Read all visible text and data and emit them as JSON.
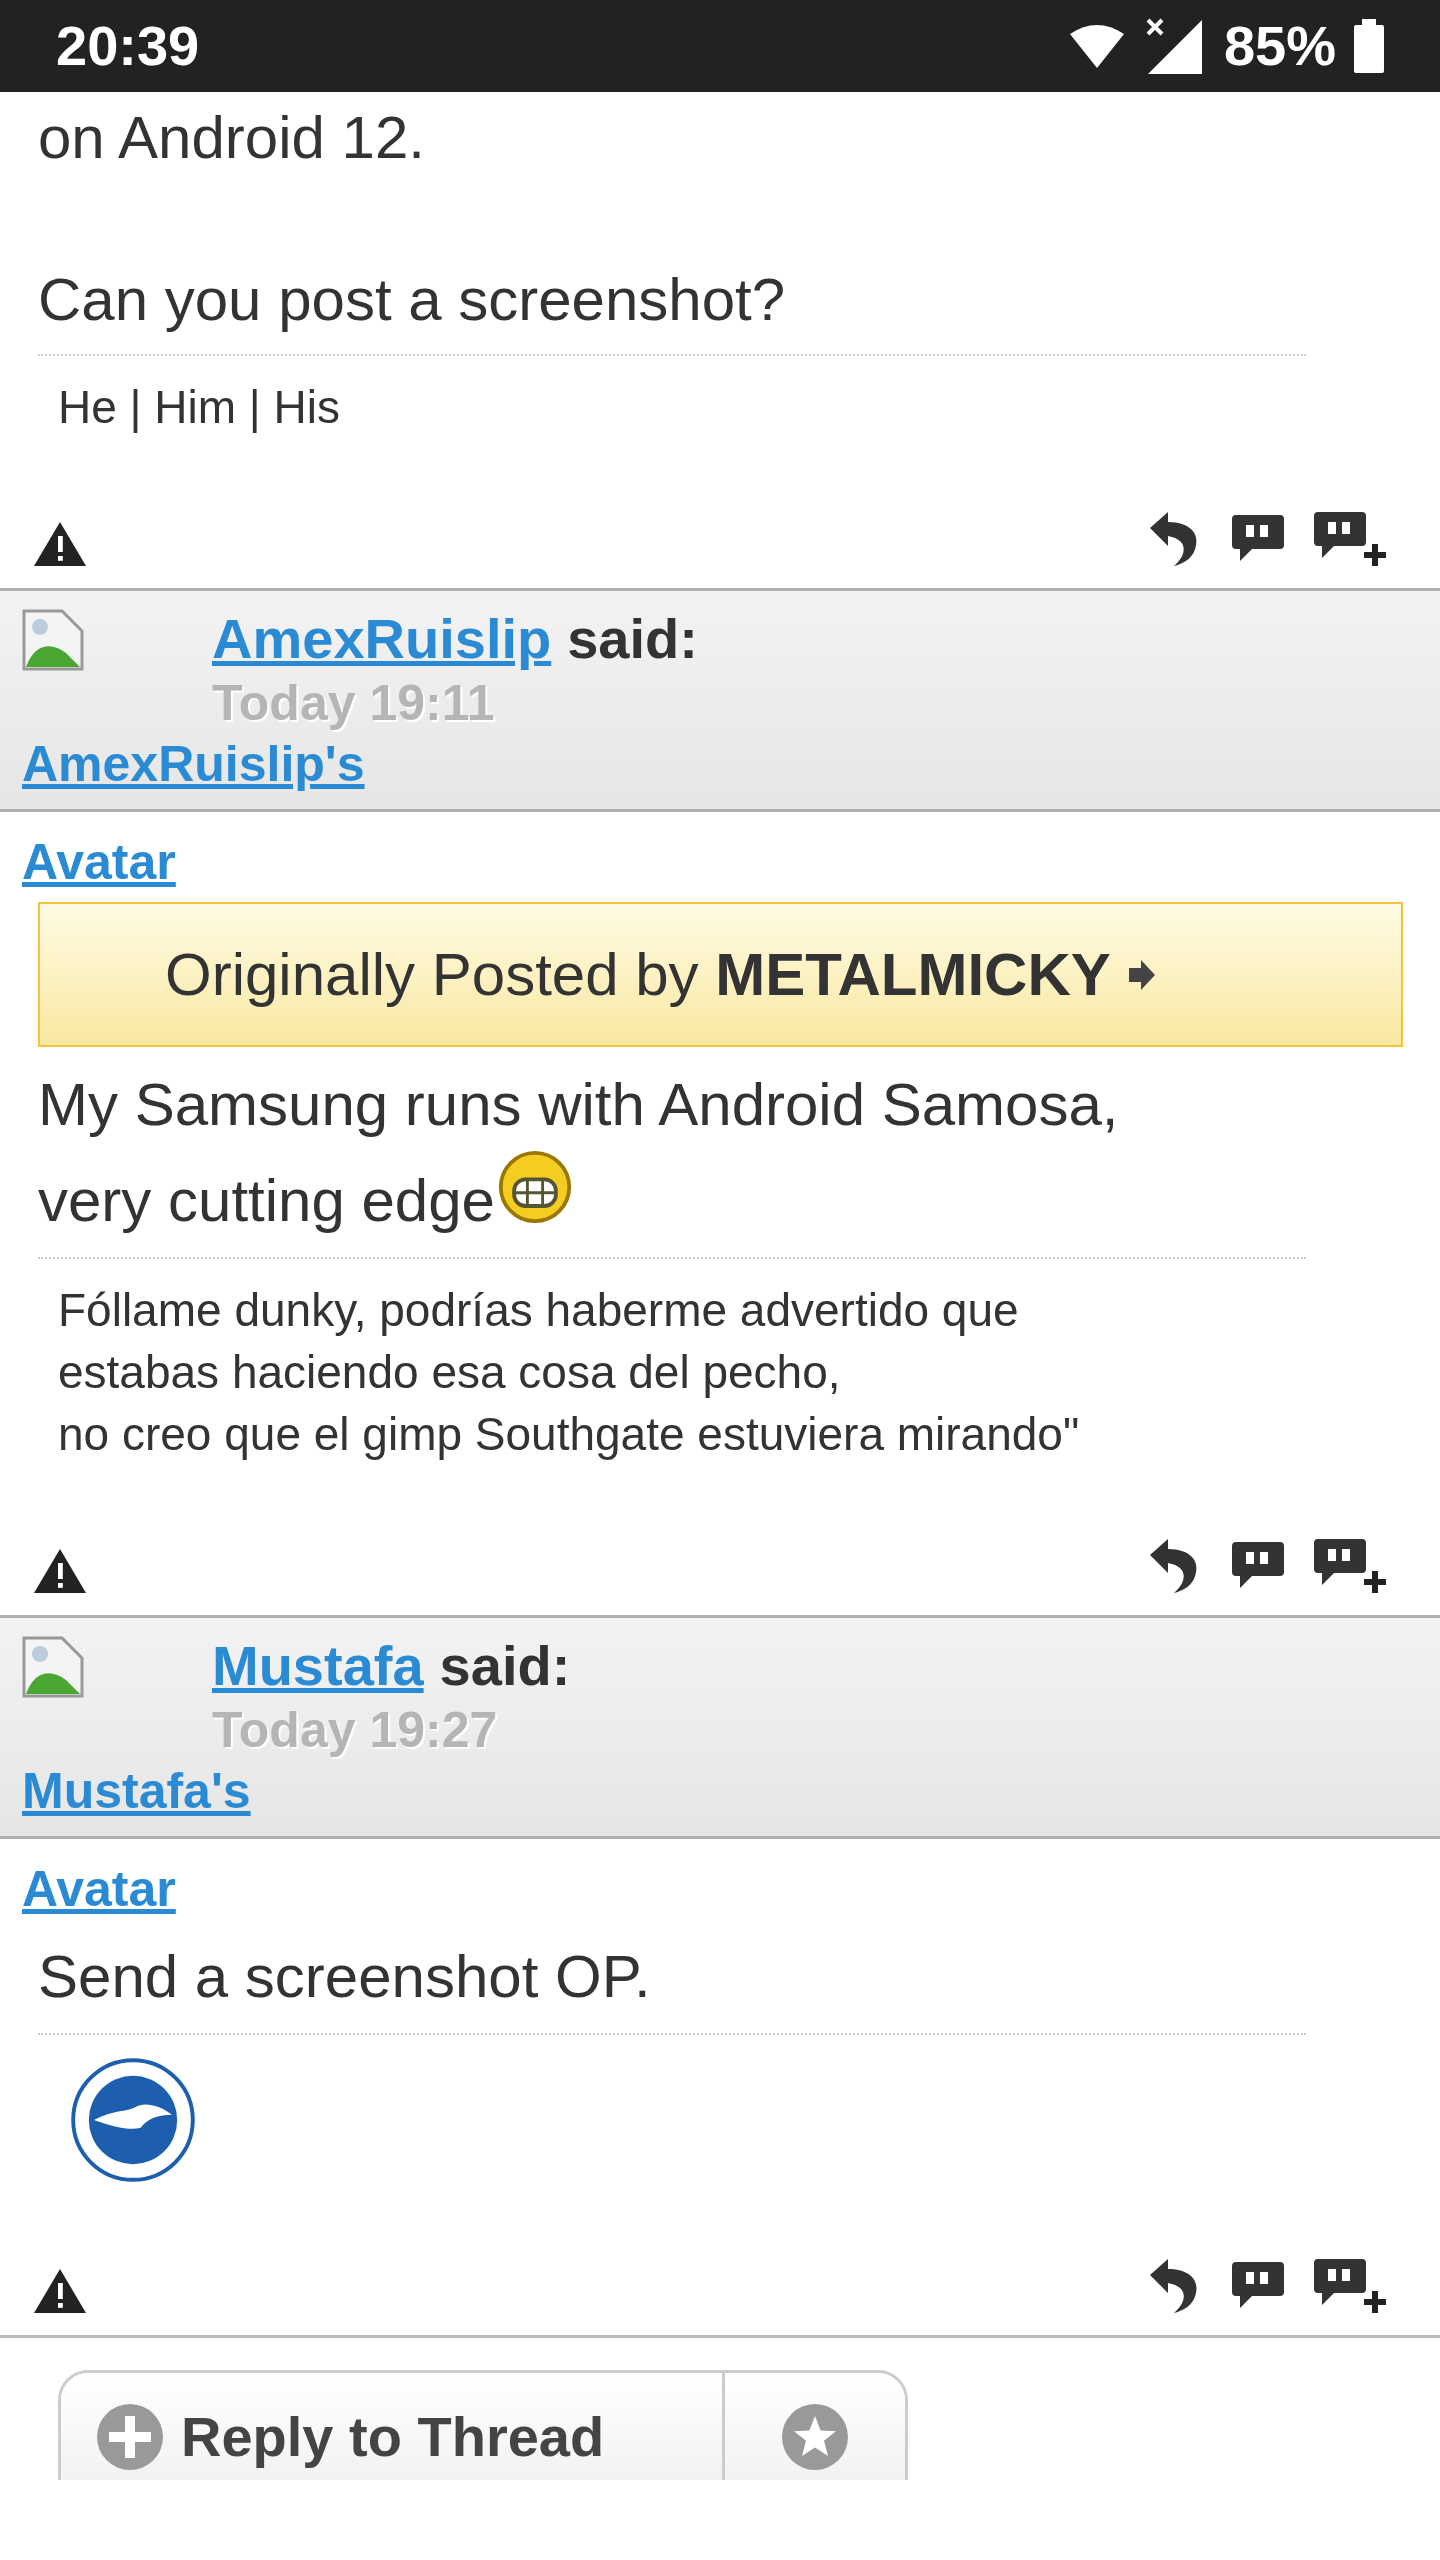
{
  "status_bar": {
    "time": "20:39",
    "battery": "85%"
  },
  "top_post": {
    "message": [
      "on Android 12.",
      "Can you post a screenshot?"
    ],
    "signature": [
      "He | Him | His"
    ]
  },
  "posts": [
    {
      "author": "AmexRuislip",
      "said": "said:",
      "date": "Today 19:11",
      "avatar_alt": "AmexRuislip's",
      "body_alt": "Avatar",
      "quote": {
        "prefix": "Originally Posted by",
        "author": "METALMICKY"
      },
      "message": [
        "My Samsung runs with Android Samosa,",
        "very cutting edge"
      ],
      "emoji": true,
      "signature": {
        "kind": "text",
        "lines": [
          "Fóllame dunky, podrías haberme advertido que",
          "estabas haciendo esa cosa del pecho,",
          "no creo que el gimp Southgate estuviera mirando\""
        ]
      }
    },
    {
      "author": "Mustafa",
      "said": "said:",
      "date": "Today 19:27",
      "avatar_alt": "Mustafa's",
      "body_alt": "Avatar",
      "message": [
        "Send a screenshot OP."
      ],
      "emoji": false,
      "signature": {
        "kind": "crest"
      }
    }
  ],
  "reply_button": "Reply to Thread"
}
